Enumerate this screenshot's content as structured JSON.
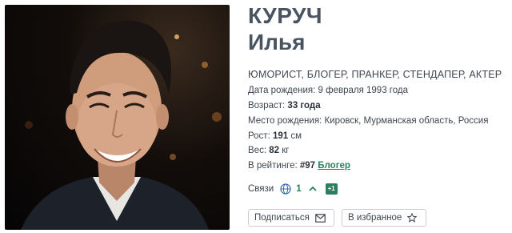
{
  "profile": {
    "surname": "КУРУЧ",
    "first_name": "Илья",
    "roles": "ЮМОРИСТ, БЛОГЕР, ПРАНКЕР, СТЕНДАПЕР, АКТЕР",
    "birth_date_label": "Дата рождения:",
    "birth_date_value": "9 февраля 1993 года",
    "age_label": "Возраст:",
    "age_value": "33 года",
    "birthplace_label": "Место рождения:",
    "birthplace_value": "Кировск, Мурманская область, Россия",
    "height_label": "Рост:",
    "height_value": "191",
    "height_unit": "см",
    "weight_label": "Вес:",
    "weight_value": "82",
    "weight_unit": "кг",
    "rating_label": "В рейтинге:",
    "rating_value": "#97",
    "rating_category": "Блогер"
  },
  "links": {
    "label": "Связи",
    "count": "1",
    "badge": "+1",
    "icon": "globe-icon",
    "chevron": "chevron-up-icon"
  },
  "actions": {
    "subscribe_label": "Подписаться",
    "subscribe_icon": "mail-icon",
    "favorite_label": "В избранное",
    "favorite_icon": "star-icon"
  },
  "colors": {
    "accent": "#2a7f5f",
    "title": "#4a5361",
    "text": "#3f4650"
  }
}
